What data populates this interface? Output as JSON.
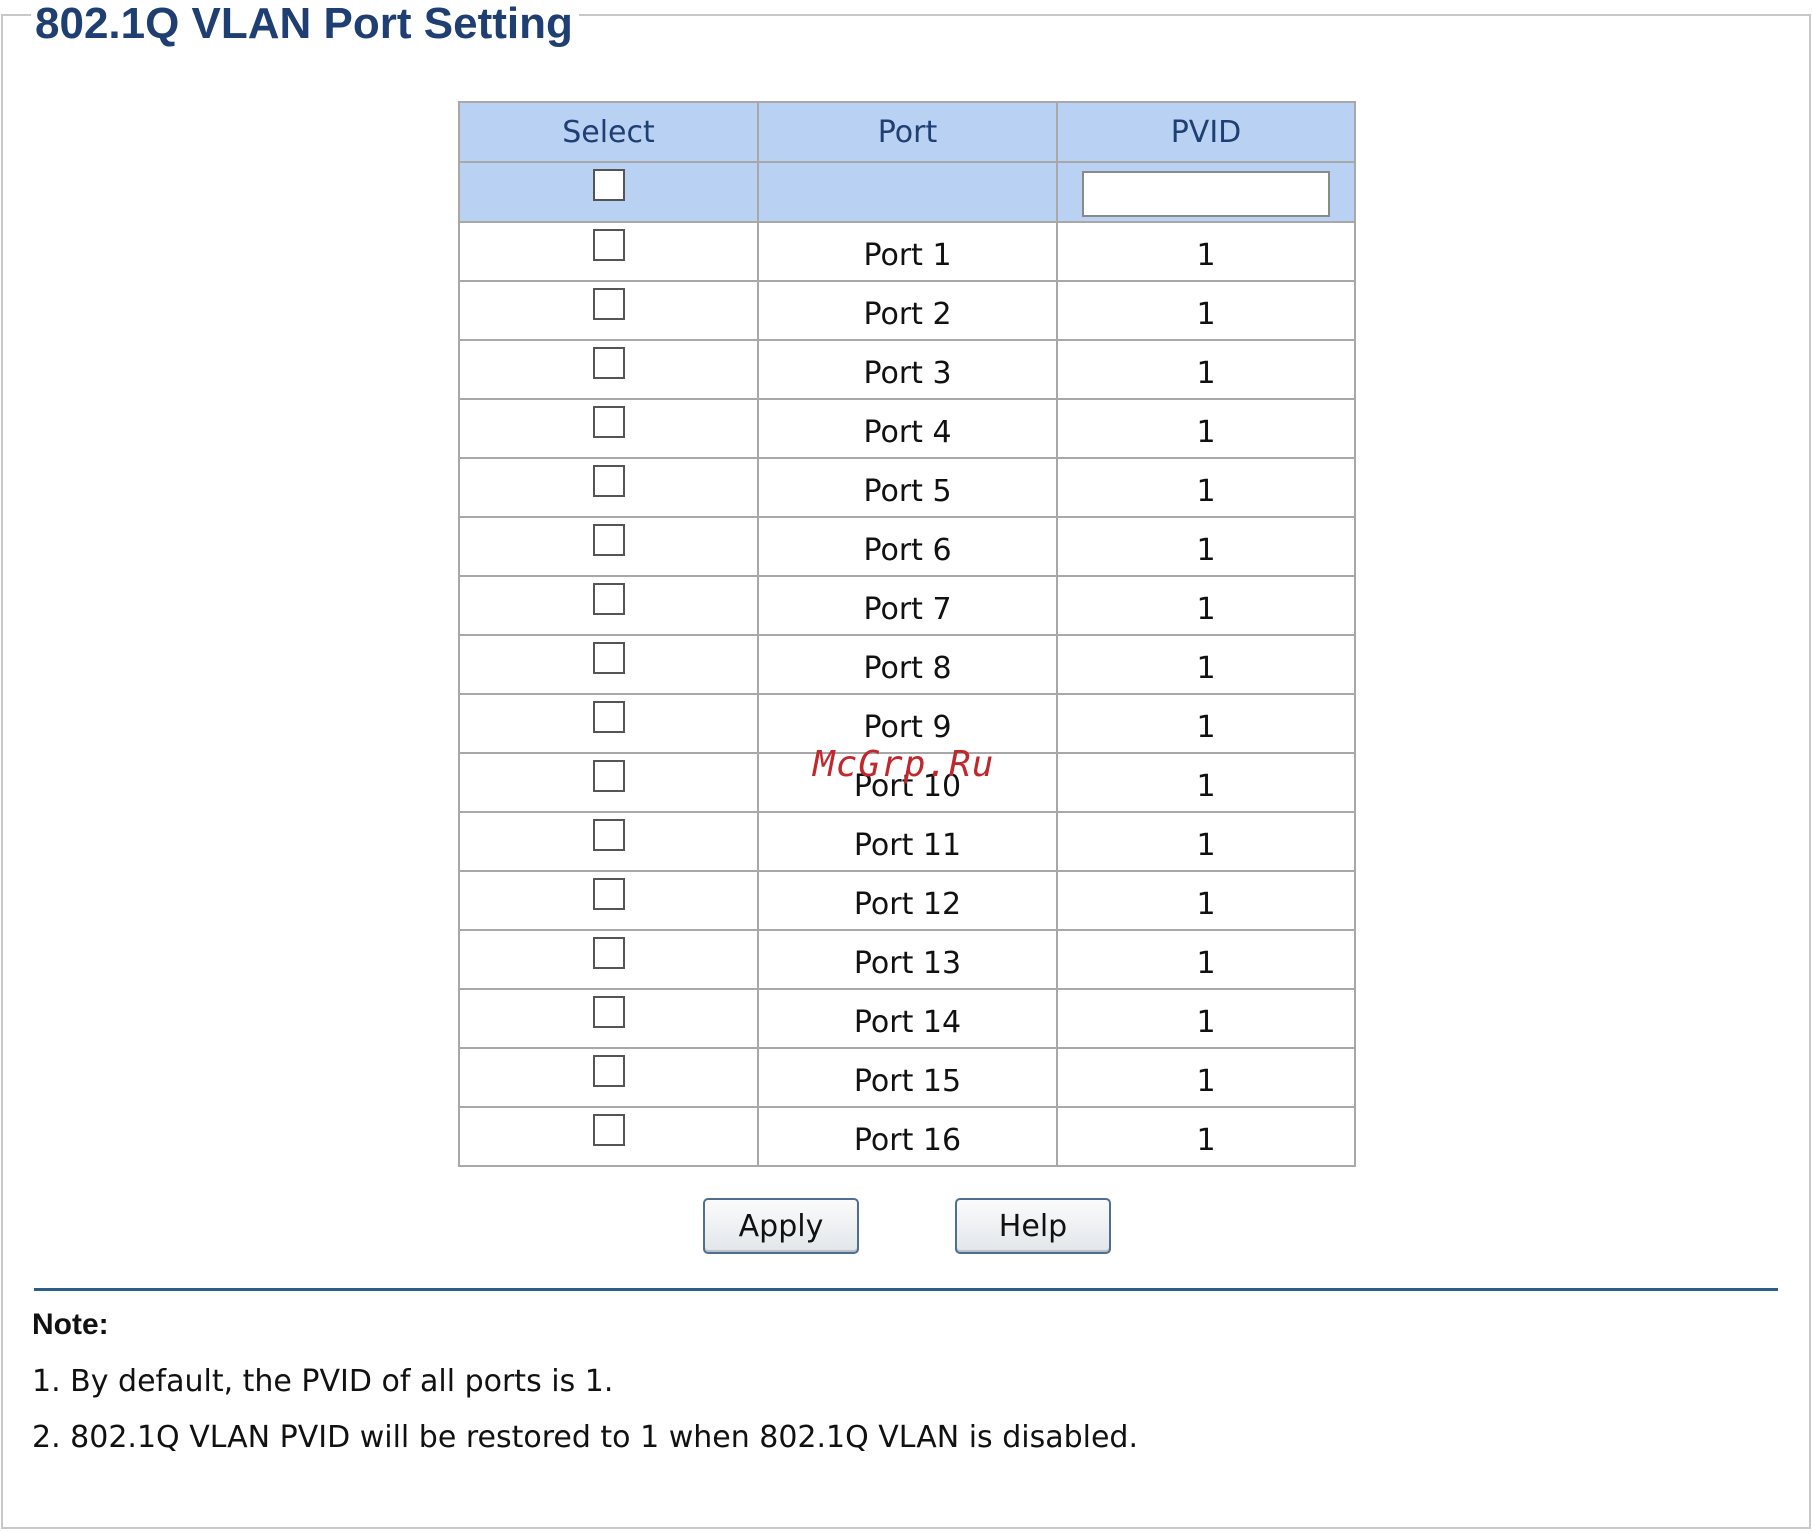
{
  "page": {
    "title": "802.1Q VLAN Port Setting"
  },
  "table": {
    "headers": {
      "select": "Select",
      "port": "Port",
      "pvid": "PVID"
    },
    "select_all": {
      "checked": false,
      "pvid_value": ""
    },
    "rows": [
      {
        "port": "Port 1",
        "pvid": "1",
        "checked": false
      },
      {
        "port": "Port 2",
        "pvid": "1",
        "checked": false
      },
      {
        "port": "Port 3",
        "pvid": "1",
        "checked": false
      },
      {
        "port": "Port 4",
        "pvid": "1",
        "checked": false
      },
      {
        "port": "Port 5",
        "pvid": "1",
        "checked": false
      },
      {
        "port": "Port 6",
        "pvid": "1",
        "checked": false
      },
      {
        "port": "Port 7",
        "pvid": "1",
        "checked": false
      },
      {
        "port": "Port 8",
        "pvid": "1",
        "checked": false
      },
      {
        "port": "Port 9",
        "pvid": "1",
        "checked": false
      },
      {
        "port": "Port 10",
        "pvid": "1",
        "checked": false
      },
      {
        "port": "Port 11",
        "pvid": "1",
        "checked": false
      },
      {
        "port": "Port 12",
        "pvid": "1",
        "checked": false
      },
      {
        "port": "Port 13",
        "pvid": "1",
        "checked": false
      },
      {
        "port": "Port 14",
        "pvid": "1",
        "checked": false
      },
      {
        "port": "Port 15",
        "pvid": "1",
        "checked": false
      },
      {
        "port": "Port 16",
        "pvid": "1",
        "checked": false
      }
    ]
  },
  "buttons": {
    "apply": "Apply",
    "help": "Help"
  },
  "note": {
    "title": "Note:",
    "lines": [
      "1. By default, the PVID of all ports is 1.",
      "2. 802.1Q VLAN PVID will be restored to 1 when 802.1Q VLAN is disabled."
    ]
  },
  "watermark": "McGrp.Ru",
  "colors": {
    "title": "#1f3f73",
    "header_bg": "#b9d1f2",
    "divider": "#2a5f8a",
    "watermark": "#c0282d"
  }
}
